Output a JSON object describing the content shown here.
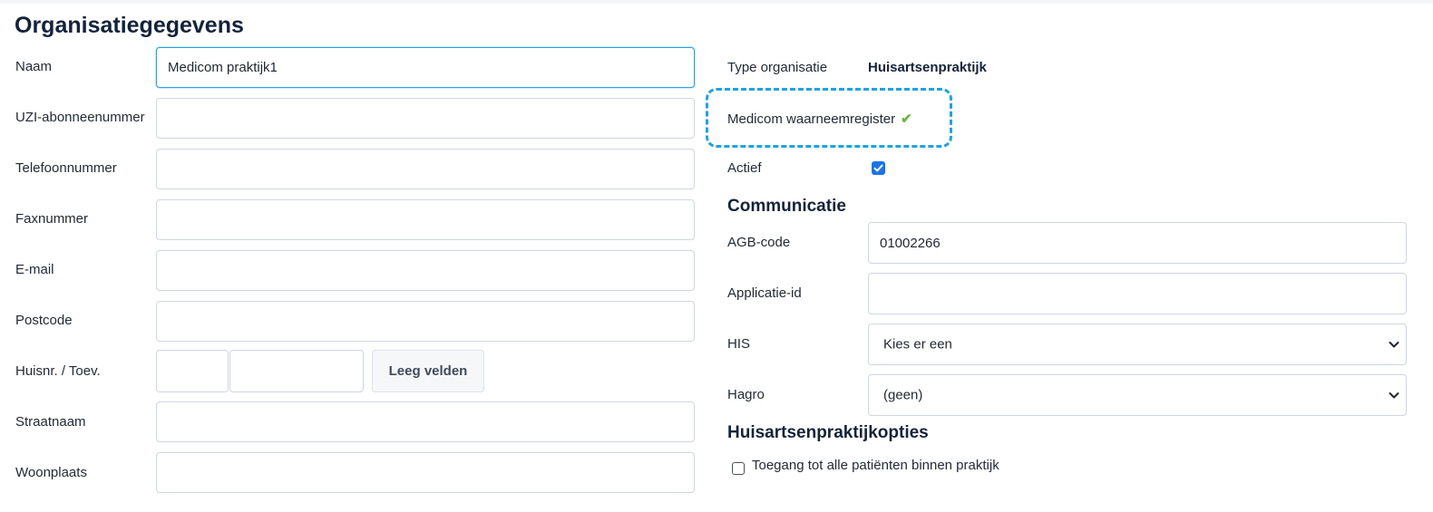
{
  "organisation": {
    "title": "Organisatiegegevens",
    "fields": {
      "naam": {
        "label": "Naam",
        "value": "Medicom praktijk1"
      },
      "uzi": {
        "label": "UZI-abonneenummer",
        "value": ""
      },
      "telefoon": {
        "label": "Telefoonnummer",
        "value": ""
      },
      "fax": {
        "label": "Faxnummer",
        "value": ""
      },
      "email": {
        "label": "E-mail",
        "value": ""
      },
      "postcode": {
        "label": "Postcode",
        "value": ""
      },
      "huisnr": {
        "label": "Huisnr. / Toev.",
        "value": "",
        "toevoeging": ""
      },
      "straatnaam": {
        "label": "Straatnaam",
        "value": ""
      },
      "woonplaats": {
        "label": "Woonplaats",
        "value": ""
      }
    },
    "clear_button_label": "Leeg velden"
  },
  "details": {
    "type_label": "Type organisatie",
    "type_value": "Huisartsenpraktijk",
    "register_label": "Medicom waarneemregister",
    "register_icon": "checkmark-icon",
    "register_icon_color": "#6cb33f",
    "actief_label": "Actief",
    "actief_checked": true
  },
  "communicatie": {
    "title": "Communicatie",
    "agb": {
      "label": "AGB-code",
      "value": "01002266"
    },
    "applicatie": {
      "label": "Applicatie-id",
      "value": ""
    },
    "his": {
      "label": "HIS",
      "selected": "Kies er een"
    },
    "hagro": {
      "label": "Hagro",
      "selected": "(geen)"
    }
  },
  "opties": {
    "title": "Huisartsenpraktijkopties",
    "toegang_label": "Toegang tot alle patiënten binnen praktijk",
    "toegang_checked": false
  },
  "colors": {
    "accent": "#1ea2e4",
    "checkbox": "#1a73e8",
    "heading": "#13233a"
  }
}
